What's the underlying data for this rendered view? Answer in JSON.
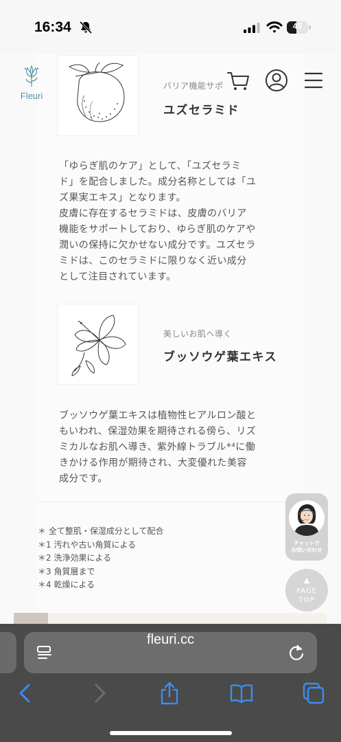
{
  "status_bar": {
    "time": "16:34",
    "battery_level": "45",
    "icons": [
      "bell-slash-icon",
      "signal-icon",
      "wifi-icon",
      "battery-icon"
    ]
  },
  "header": {
    "logo_text": "Fleuri",
    "icons": [
      "cart-icon",
      "user-icon",
      "menu-icon"
    ]
  },
  "ingredients": [
    {
      "sub": "バリア機能サポ",
      "title": "ユズセラミド",
      "lines": [
        "「ゆらぎ肌のケア」として、「ユズセラミ",
        "ド」を配合しました。成分名称としては「ユ",
        "ズ果実エキス」となります。",
        "皮膚に存在するセラミドは、皮膚のバリア",
        "機能をサポートしており、ゆらぎ肌のケアや",
        "潤いの保持に欠かせない成分です。ユズセラ",
        "ミドは、このセラミドに限りなく近い成分",
        "として注目されています。"
      ]
    },
    {
      "sub": "美しいお肌へ導く",
      "title": "ブッソウゲ葉エキス",
      "lines": [
        "ブッソウゲ葉エキスは植物性ヒアルロン酸と",
        "もいわれ、保湿効果を期待される傍ら、リズ",
        "ミカルなお肌へ導き、紫外線トラブル*⁴に働",
        "きかける作用が期待され、大変優れた美容",
        "成分です。"
      ]
    }
  ],
  "notes": [
    "＊ 全て整肌・保湿成分として配合",
    "＊1 汚れや古い角質による",
    "＊2 洗浄効果による",
    "＊3 角質層まで",
    "＊4 乾燥による"
  ],
  "chat_widget": {
    "line1": "チャットで",
    "line2": "お問い合わせ"
  },
  "page_top": {
    "arrow": "▲",
    "line1": "PAGE",
    "line2": "TOP"
  },
  "browser": {
    "url": "fleuri.cc",
    "toolbar_icons": [
      "back-icon",
      "forward-icon",
      "share-icon",
      "bookmarks-icon",
      "tabs-icon"
    ]
  }
}
